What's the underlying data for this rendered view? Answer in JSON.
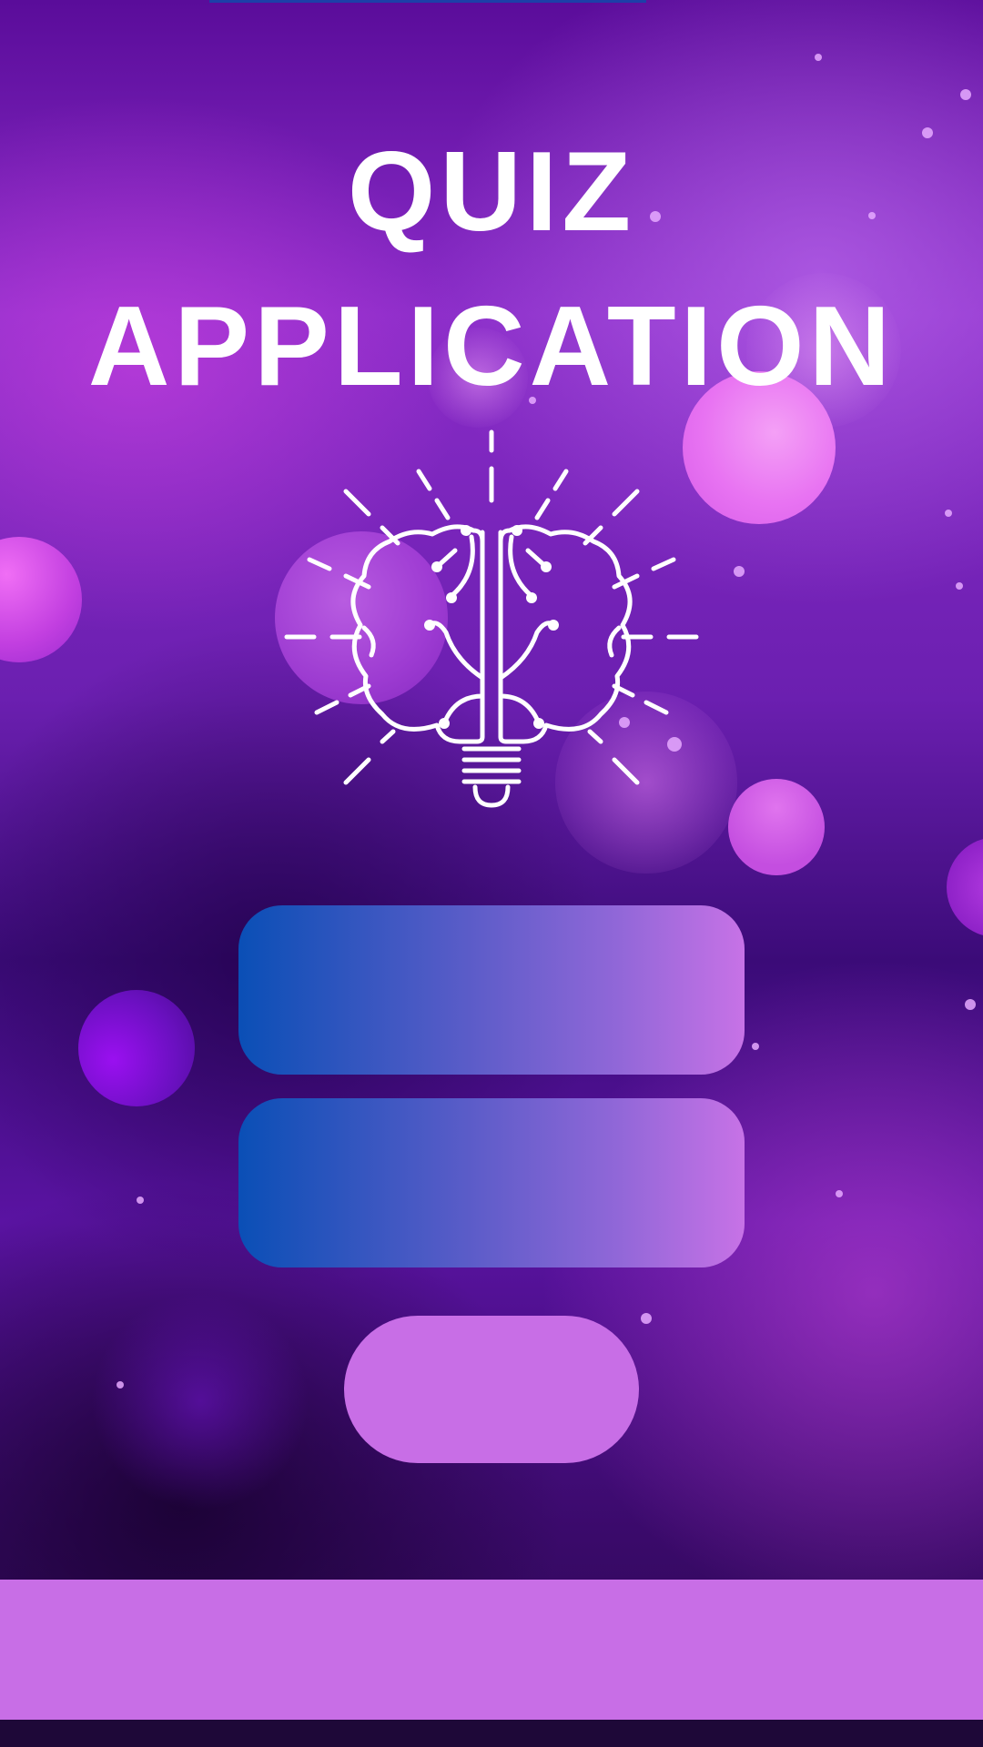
{
  "app": {
    "title_line1": "QUIZ",
    "title_line2": "APPLICATION"
  },
  "icons": {
    "hero": "brain-lightbulb-icon"
  },
  "buttons": {
    "option_1_label": "",
    "option_2_label": "",
    "start_label": ""
  },
  "colors": {
    "accent": "#c86ee6",
    "button_gradient_start": "#0a4fb6",
    "button_gradient_end": "#c772e6",
    "title": "#ffffff"
  }
}
